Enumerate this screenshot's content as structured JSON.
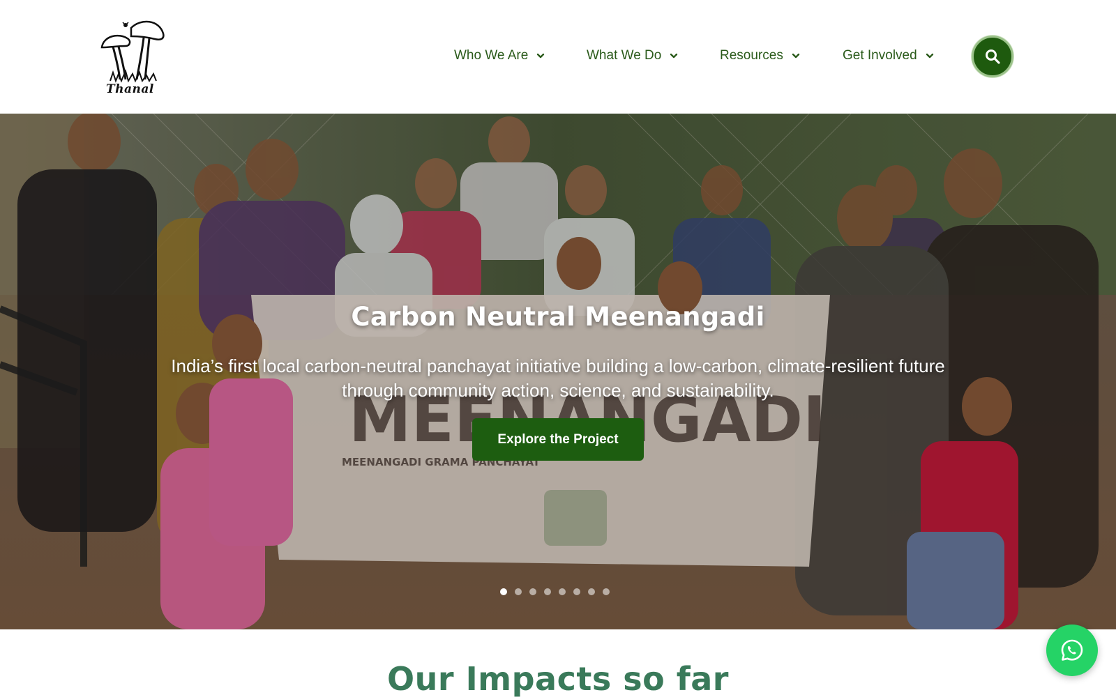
{
  "brand": {
    "logo_text": "Thanal"
  },
  "nav": {
    "items": [
      {
        "label": "Who We Are"
      },
      {
        "label": "What We Do"
      },
      {
        "label": "Resources"
      },
      {
        "label": "Get Involved"
      }
    ],
    "search_icon": "search-icon",
    "accent_color": "#1e5a0e",
    "text_color": "#2a5a1a"
  },
  "hero": {
    "title": "Carbon Neutral Meenangadi",
    "subtitle_line1": "India’s first local carbon-neutral panchayat initiative building a low-carbon, climate-resilient future",
    "subtitle_line2": "through community action, science, and sustainability.",
    "cta_label": "Explore the Project",
    "cta_color": "#1d5d10",
    "slides_total": 8,
    "active_slide": 1
  },
  "impacts": {
    "title": "Our Impacts so far",
    "title_color": "#3a7a5a"
  },
  "whatsapp": {
    "icon": "whatsapp-icon",
    "color": "#25d366"
  }
}
